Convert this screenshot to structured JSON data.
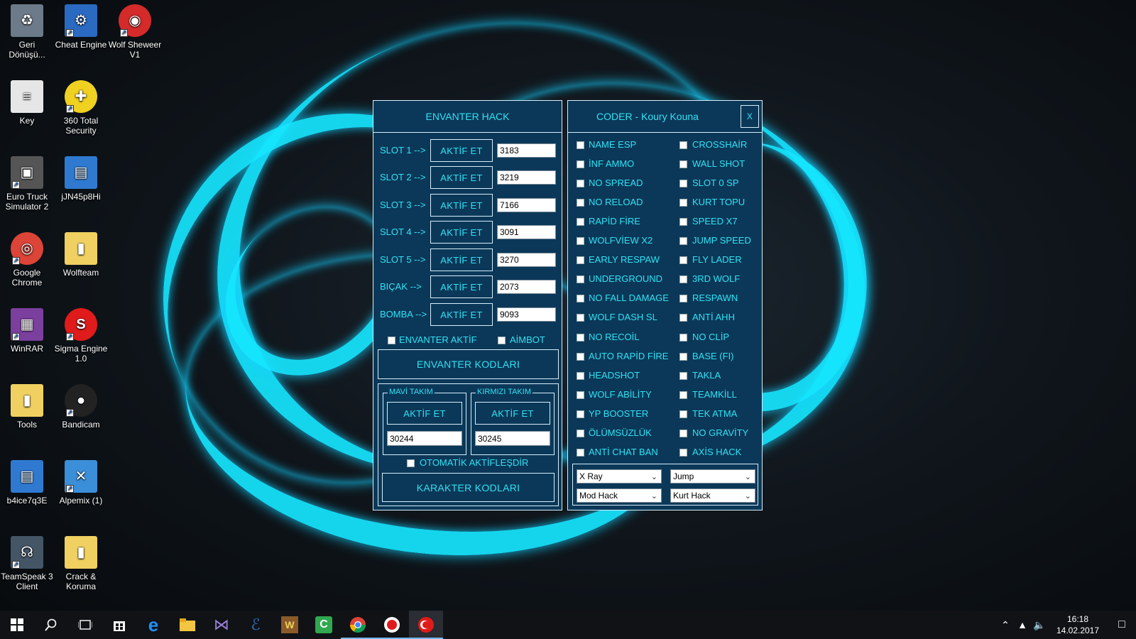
{
  "desktop_icons": [
    {
      "label": "Geri Dönüşü...",
      "icon": "recycle-bin-icon"
    },
    {
      "label": "Cheat Engine",
      "icon": "cheat-engine-icon"
    },
    {
      "label": "Wolf Sheweer V1",
      "icon": "wolf-sheweer-icon"
    },
    {
      "label": "Key",
      "icon": "text-document-icon"
    },
    {
      "label": "360 Total Security",
      "icon": "360-security-icon"
    },
    {
      "label": "Euro Truck Simulator 2",
      "icon": "truck-icon"
    },
    {
      "label": "jJN45p8Hi",
      "icon": "window-app-icon"
    },
    {
      "label": "Google Chrome",
      "icon": "chrome-icon"
    },
    {
      "label": "Wolfteam",
      "icon": "folder-icon"
    },
    {
      "label": "WinRAR",
      "icon": "winrar-icon"
    },
    {
      "label": "Sigma Engine 1.0",
      "icon": "sigma-engine-icon"
    },
    {
      "label": "Tools",
      "icon": "folder-icon"
    },
    {
      "label": "Bandicam",
      "icon": "bandicam-icon"
    },
    {
      "label": "b4ice7q3E",
      "icon": "window-app-icon"
    },
    {
      "label": "Alpemix (1)",
      "icon": "alpemix-icon"
    },
    {
      "label": "TeamSpeak 3 Client",
      "icon": "teamspeak-icon"
    },
    {
      "label": "Crack & Koruma",
      "icon": "folder-icon"
    }
  ],
  "envanter": {
    "title": "ENVANTER HACK",
    "slots": [
      {
        "label": "SLOT 1 -->",
        "button": "AKTİF ET",
        "value": "3183"
      },
      {
        "label": "SLOT 2 -->",
        "button": "AKTİF ET",
        "value": "3219"
      },
      {
        "label": "SLOT 3 -->",
        "button": "AKTİF ET",
        "value": "7166"
      },
      {
        "label": "SLOT 4 -->",
        "button": "AKTİF ET",
        "value": "3091"
      },
      {
        "label": "SLOT 5 -->",
        "button": "AKTİF ET",
        "value": "3270"
      },
      {
        "label": "BIÇAK -->",
        "button": "AKTİF ET",
        "value": "2073"
      },
      {
        "label": "BOMBA -->",
        "button": "AKTİF ET",
        "value": "9093"
      }
    ],
    "envanter_aktif": "ENVANTER AKTİF",
    "aimbot": "AİMBOT",
    "kodlari_button": "ENVANTER KODLARI",
    "mavi_takim": {
      "legend": "MAVİ TAKIM",
      "button": "AKTİF ET",
      "value": "30244"
    },
    "kirmizi_takim": {
      "legend": "KIRMIZI TAKIM",
      "button": "AKTİF ET",
      "value": "30245"
    },
    "otomatik": "OTOMATİK AKTİFLEŞDİR",
    "karakter_button": "KARAKTER KODLARI"
  },
  "coder": {
    "title": "CODER - Koury Kouna",
    "close": "X",
    "left_options": [
      "NAME ESP",
      "İNF AMMO",
      "NO SPREAD",
      "NO RELOAD",
      "RAPİD FİRE",
      "WOLFVİEW X2",
      "EARLY RESPAW",
      "UNDERGROUND",
      "NO FALL DAMAGE",
      "WOLF DASH SL",
      "NO RECOİL",
      "AUTO RAPİD FİRE",
      "HEADSHOT",
      "WOLF ABİLİTY",
      "YP BOOSTER",
      "ÖLÜMSÜZLÜK",
      "ANTİ CHAT BAN"
    ],
    "right_options": [
      "CROSSHAİR",
      "WALL SHOT",
      "SLOT 0 SP",
      "KURT TOPU",
      "SPEED X7",
      "JUMP SPEED",
      "FLY LADER",
      "3RD WOLF",
      "RESPAWN",
      "ANTİ AHH",
      "NO CLİP",
      "BASE (FI)",
      "TAKLA",
      "TEAMKİLL",
      "TEK ATMA",
      "NO GRAVİTY",
      "AXİS HACK"
    ],
    "selects": [
      "X Ray",
      "Jump",
      "Mod Hack",
      "Kurt Hack"
    ]
  },
  "taskbar": {
    "clock_time": "16:18",
    "clock_date": "14.02.2017"
  },
  "colors": {
    "accent": "#30e2f5",
    "panel": "#0b3858",
    "border": "#d6eefb",
    "glow": "#16e6ff"
  }
}
